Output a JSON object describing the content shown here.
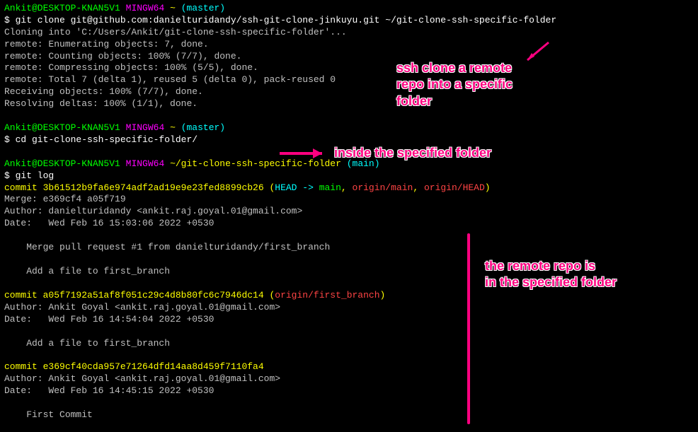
{
  "prompt1": {
    "user": "Ankit@DESKTOP-KNAN5V1",
    "env": "MINGW64",
    "path": "~",
    "branch": "(master)"
  },
  "cmd1": "$ git clone git@github.com:danielturidandy/ssh-git-clone-jinkuyu.git ~/git-clone-ssh-specific-folder",
  "clone_out": [
    "Cloning into 'C:/Users/Ankit/git-clone-ssh-specific-folder'...",
    "remote: Enumerating objects: 7, done.",
    "remote: Counting objects: 100% (7/7), done.",
    "remote: Compressing objects: 100% (5/5), done.",
    "remote: Total 7 (delta 1), reused 5 (delta 0), pack-reused 0",
    "Receiving objects: 100% (7/7), done.",
    "Resolving deltas: 100% (1/1), done."
  ],
  "prompt2": {
    "user": "Ankit@DESKTOP-KNAN5V1",
    "env": "MINGW64",
    "path": "~",
    "branch": "(master)"
  },
  "cmd2": "$ cd git-clone-ssh-specific-folder/",
  "prompt3": {
    "user": "Ankit@DESKTOP-KNAN5V1",
    "env": "MINGW64",
    "path": "~/git-clone-ssh-specific-folder",
    "branch": "(main)"
  },
  "cmd3": "$ git log",
  "commit1": {
    "hash_label": "commit ",
    "hash": "3b61512b9fa6e974adf2ad19e9e23fed8899cb26",
    "paren_open": " (",
    "head": "HEAD -> ",
    "main": "main",
    "sep1": ", ",
    "origin_main": "origin/main",
    "sep2": ", ",
    "origin_head": "origin/HEAD",
    "paren_close": ")",
    "merge": "Merge: e369cf4 a05f719",
    "author": "Author: danielturidandy <ankit.raj.goyal.01@gmail.com>",
    "date": "Date:   Wed Feb 16 15:03:06 2022 +0530",
    "msg1": "    Merge pull request #1 from danielturidandy/first_branch",
    "msg2": "    Add a file to first_branch"
  },
  "commit2": {
    "hash_label": "commit ",
    "hash": "a05f7192a51af8f051c29c4d8b80fc6c7946dc14",
    "paren_open": " (",
    "ref": "origin/first_branch",
    "paren_close": ")",
    "author": "Author: Ankit Goyal <ankit.raj.goyal.01@gmail.com>",
    "date": "Date:   Wed Feb 16 14:54:04 2022 +0530",
    "msg": "    Add a file to first_branch"
  },
  "commit3": {
    "hash_label": "commit ",
    "hash": "e369cf40cda957e71264dfd14aa8d459f7110fa4",
    "author": "Author: Ankit Goyal <ankit.raj.goyal.01@gmail.com>",
    "date": "Date:   Wed Feb 16 14:45:15 2022 +0530",
    "msg": "    First Commit"
  },
  "annotations": {
    "a1": "ssh clone a remote\nrepo into a specific\nfolder",
    "a2": "inside the specified folder",
    "a3": "the remote repo is\nin the specified folder"
  }
}
